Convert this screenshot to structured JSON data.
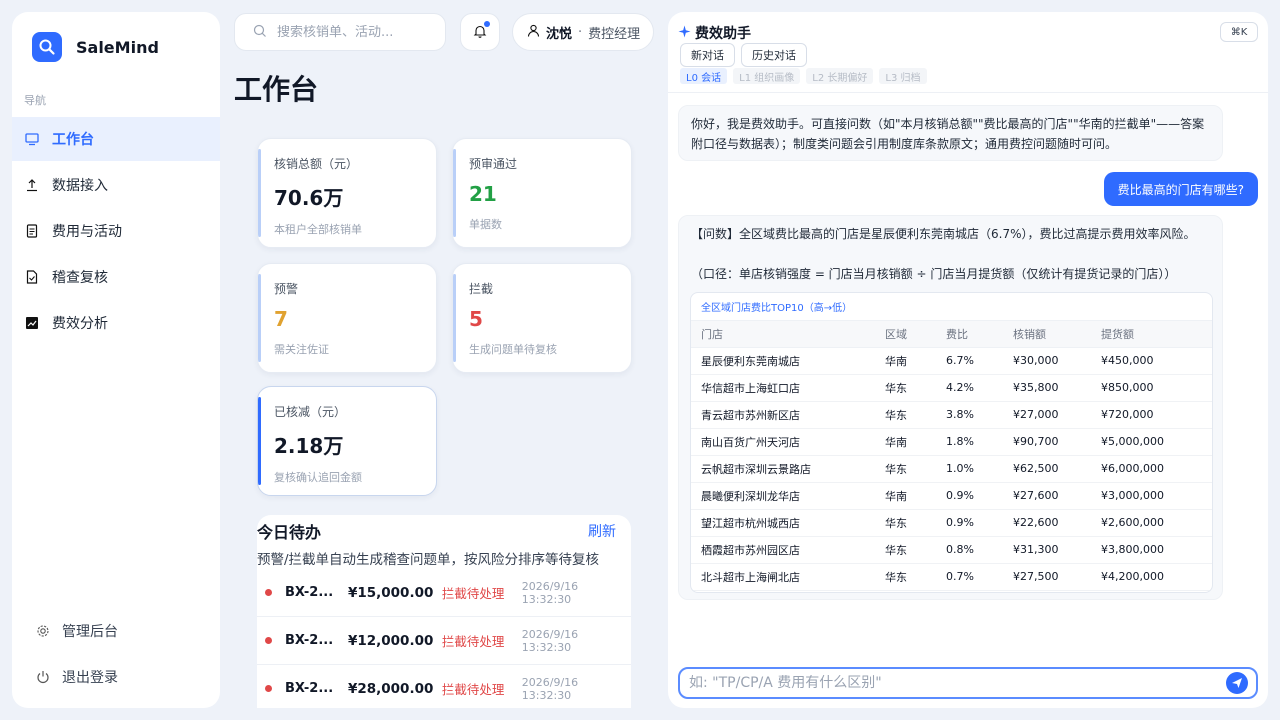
{
  "brand": {
    "name": "SaleMind",
    "logo_icon": "magnifier-icon"
  },
  "sidebar": {
    "heading": "导航",
    "items": [
      {
        "label": "工作台",
        "icon": "monitor-icon",
        "active": true
      },
      {
        "label": "数据接入",
        "icon": "upload-icon"
      },
      {
        "label": "费用与活动",
        "icon": "document-icon"
      },
      {
        "label": "稽查复核",
        "icon": "file-check-icon"
      },
      {
        "label": "费效分析",
        "icon": "chart-icon"
      }
    ],
    "bottom": [
      {
        "label": "管理后台",
        "icon": "gear-icon"
      },
      {
        "label": "退出登录",
        "icon": "power-icon"
      }
    ]
  },
  "header": {
    "search_placeholder": "搜索核销单、活动...",
    "user_name": "沈悦",
    "user_sep": "·",
    "user_role": "费控经理"
  },
  "page": {
    "title": "工作台"
  },
  "cards": [
    {
      "label": "核销总额（元）",
      "value": "70.6万",
      "sub": "本租户全部核销单",
      "value_color": "#111827"
    },
    {
      "label": "预审通过",
      "value": "21",
      "sub": "单据数",
      "value_color": "#22a045"
    },
    {
      "label": "预警",
      "value": "7",
      "sub": "需关注佐证",
      "value_color": "#e0a230"
    },
    {
      "label": "拦截",
      "value": "5",
      "sub": "生成问题单待复核",
      "value_color": "#e04848"
    },
    {
      "label": "已核减（元）",
      "value": "2.18万",
      "sub": "复核确认追回金额",
      "value_color": "#111827"
    }
  ],
  "todo": {
    "title": "今日待办",
    "refresh": "刷新",
    "desc": "预警/拦截单自动生成稽查问题单，按风险分排序等待复核",
    "rows": [
      {
        "code": "BX-2...",
        "amount": "¥15,000.00",
        "status": "拦截待处理",
        "time": "2026/9/16 13:32:30"
      },
      {
        "code": "BX-2...",
        "amount": "¥12,000.00",
        "status": "拦截待处理",
        "time": "2026/9/16 13:32:30"
      },
      {
        "code": "BX-2...",
        "amount": "¥28,000.00",
        "status": "拦截待处理",
        "time": "2026/9/16 13:32:30"
      }
    ]
  },
  "assistant": {
    "title": "费效助手",
    "shortcut": "⌘K",
    "buttons": [
      "新对话",
      "历史对话"
    ],
    "levels": [
      "L0 会话",
      "L1 组织画像",
      "L2 长期偏好",
      "L3 归档"
    ],
    "greeting": "你好，我是费效助手。可直接问数（如\"本月核销总额\"\"费比最高的门店\"\"华南的拦截单\"——答案附口径与数据表）；制度类问题会引用制度库条款原文；通用费控问题随时可问。",
    "user_question": "费比最高的门店有哪些?",
    "answer": "【问数】全区域费比最高的门店是星辰便利东莞南城店（6.7%），费比过高提示费用效率风险。",
    "formula": "（口径：单店核销强度 = 门店当月核销额 ÷ 门店当月提货额（仅统计有提货记录的门店））",
    "table": {
      "caption": "全区域门店费比TOP10（高→低）",
      "headers": [
        "门店",
        "区域",
        "费比",
        "核销额",
        "提货额"
      ],
      "rows": [
        [
          "星辰便利东莞南城店",
          "华南",
          "6.7%",
          "¥30,000",
          "¥450,000"
        ],
        [
          "华信超市上海虹口店",
          "华东",
          "4.2%",
          "¥35,800",
          "¥850,000"
        ],
        [
          "青云超市苏州新区店",
          "华东",
          "3.8%",
          "¥27,000",
          "¥720,000"
        ],
        [
          "南山百货广州天河店",
          "华南",
          "1.8%",
          "¥90,700",
          "¥5,000,000"
        ],
        [
          "云帆超市深圳云景路店",
          "华东",
          "1.0%",
          "¥62,500",
          "¥6,000,000"
        ],
        [
          "晨曦便利深圳龙华店",
          "华南",
          "0.9%",
          "¥27,600",
          "¥3,000,000"
        ],
        [
          "望江超市杭州城西店",
          "华东",
          "0.9%",
          "¥22,600",
          "¥2,600,000"
        ],
        [
          "栖霞超市苏州园区店",
          "华东",
          "0.8%",
          "¥31,300",
          "¥3,800,000"
        ],
        [
          "北斗超市上海闸北店",
          "华东",
          "0.7%",
          "¥27,500",
          "¥4,200,000"
        ]
      ]
    },
    "input_placeholder": "如: \"TP/CP/A 费用有什么区别\"",
    "send_icon": "send-icon"
  },
  "colors": {
    "accent": "#2f6bff",
    "danger": "#e04848",
    "warn": "#e0a230",
    "success": "#22a045"
  }
}
